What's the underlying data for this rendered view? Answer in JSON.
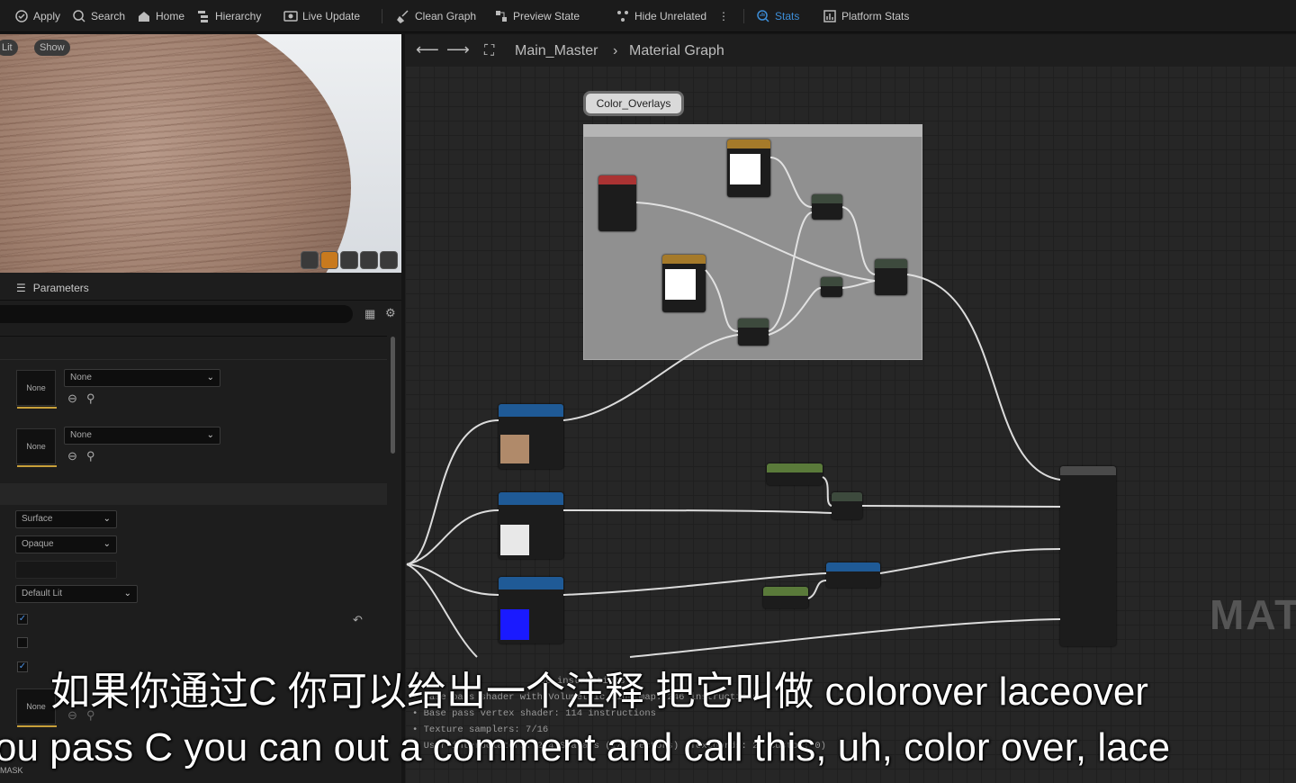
{
  "toolbar": {
    "items": [
      {
        "label": "Apply",
        "icon": "apply-icon"
      },
      {
        "label": "Search",
        "icon": "search-icon"
      },
      {
        "label": "Home",
        "icon": "home-icon"
      },
      {
        "label": "Hierarchy",
        "icon": "hierarchy-icon"
      },
      {
        "label": "Live Update",
        "icon": "live-update-icon"
      },
      {
        "label": "Clean Graph",
        "icon": "broom-icon"
      },
      {
        "label": "Preview State",
        "icon": "preview-state-icon"
      },
      {
        "label": "Hide Unrelated",
        "icon": "hide-unrelated-icon"
      },
      {
        "label": "Stats",
        "icon": "stats-icon"
      },
      {
        "label": "Platform Stats",
        "icon": "platform-stats-icon"
      }
    ]
  },
  "viewport": {
    "lit_label": "Lit",
    "show_label": "Show"
  },
  "parameters": {
    "title": "Parameters",
    "texture_slots": [
      {
        "thumb": "None",
        "value": "None"
      },
      {
        "thumb": "None",
        "value": "None"
      }
    ],
    "domain": "Surface",
    "blend": "Opaque",
    "shading": "Default Lit",
    "bottom_thumb": "None",
    "bottom_label": "MASK"
  },
  "graph": {
    "breadcrumb_root": "Main_Master",
    "breadcrumb_current": "Material Graph",
    "comment_label": "Color_Overlays",
    "watermark": "MAT",
    "summary": [
      "08 instructions",
      "Base pass shader with Volumetric Lightmap: 246 instructions",
      "Base pass vertex shader: 114 instructions",
      "Texture samplers: 7/16",
      "User interpolators: 2/4 Scalars (1/4 Vectors) (TexCoords: 2, Custom: 0)"
    ]
  },
  "subtitles": {
    "line_zh": "如果你通过C 你可以给出一个注释 把它叫做 colorover laceover",
    "line_en": "ou pass C you can out a comment and call this, uh, color over, lace"
  },
  "colors": {
    "accent": "#3d8ed8",
    "wire": "#e6e6e6",
    "comment": "#909090"
  }
}
